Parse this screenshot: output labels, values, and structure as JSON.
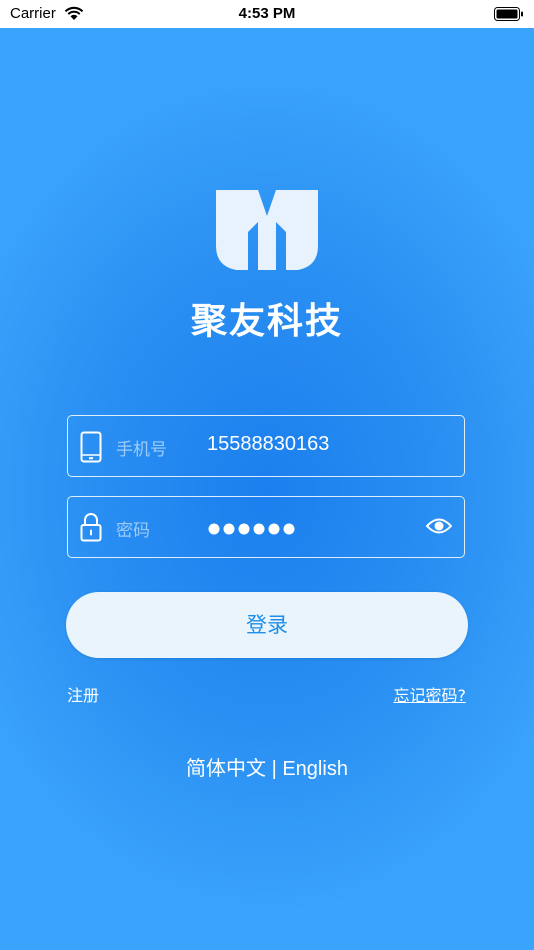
{
  "status_bar": {
    "carrier": "Carrier",
    "time": "4:53 PM"
  },
  "brand": {
    "name": "聚友科技",
    "logo_icon": "m-shield-logo"
  },
  "form": {
    "phone": {
      "label": "手机号",
      "value": "15588830163",
      "icon": "phone-icon"
    },
    "password": {
      "label": "密码",
      "masked_value": "●●●●●●",
      "icon": "lock-icon",
      "toggle_icon": "eye-icon"
    }
  },
  "actions": {
    "login_label": "登录",
    "register_label": "注册",
    "forgot_label": "忘记密码?"
  },
  "language": {
    "zh": "简体中文",
    "separator": " | ",
    "en": "English"
  },
  "colors": {
    "background": "#2a8ff2",
    "button_bg": "#e9f4fd",
    "button_text": "#1e8ee8"
  }
}
